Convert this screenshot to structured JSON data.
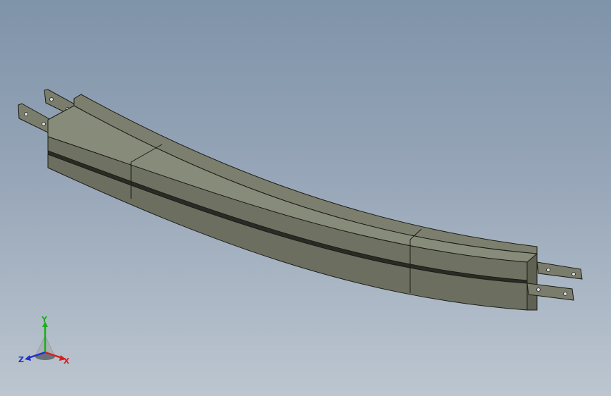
{
  "viewport": {
    "background_top": "#7f93a9",
    "background_bottom": "#bcc6d0"
  },
  "model": {
    "face_color": "#6f7262",
    "face_light": "#868a78",
    "edge_color": "#1c1c18"
  },
  "triad": {
    "x_label": "X",
    "y_label": "Y",
    "z_label": "Z",
    "x_color": "#d42020",
    "y_color": "#18b018",
    "z_color": "#2030c8"
  }
}
